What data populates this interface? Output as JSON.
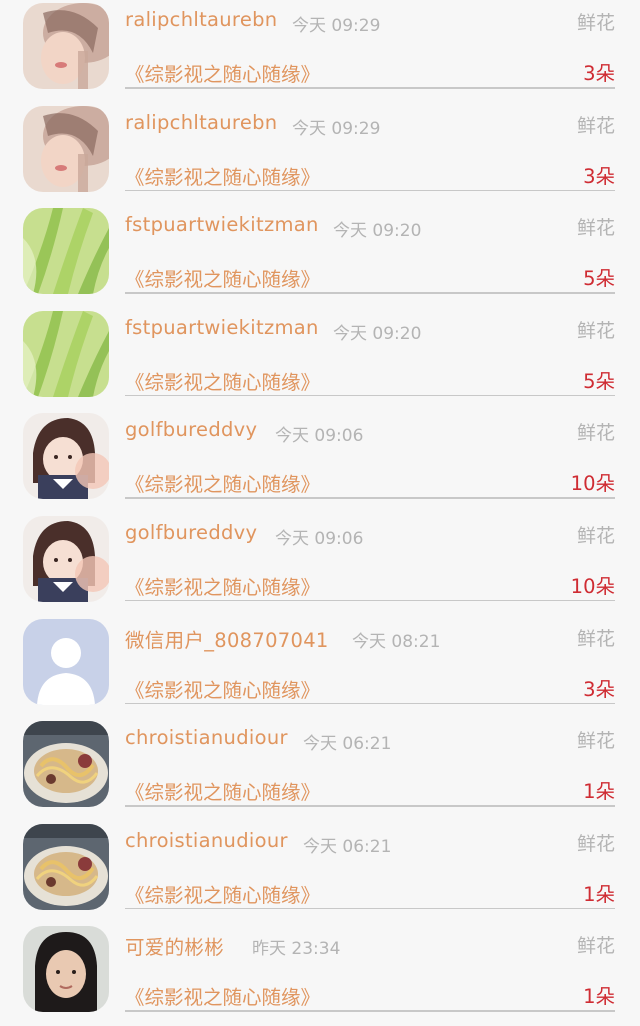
{
  "gift_label": "鲜花",
  "work_title": "《综影视之随心随缘》",
  "rows": [
    {
      "name": "ralipchltaurebn",
      "time": "今天 09:29",
      "count": "3朵",
      "avatar_icon": "user-photo-icon"
    },
    {
      "name": "ralipchltaurebn",
      "time": "今天 09:29",
      "count": "3朵",
      "avatar_icon": "user-photo-icon"
    },
    {
      "name": "fstpuartwiekitzman",
      "time": "今天 09:20",
      "count": "5朵",
      "avatar_icon": "leaf-photo-icon"
    },
    {
      "name": "fstpuartwiekitzman",
      "time": "今天 09:20",
      "count": "5朵",
      "avatar_icon": "leaf-photo-icon"
    },
    {
      "name": "golfbureddvy",
      "time": "今天 09:06",
      "count": "10朵",
      "avatar_icon": "girl-photo-icon"
    },
    {
      "name": "golfbureddvy",
      "time": "今天 09:06",
      "count": "10朵",
      "avatar_icon": "girl-photo-icon"
    },
    {
      "name": "微信用户_808707041",
      "time": "今天 08:21",
      "count": "3朵",
      "avatar_icon": "default-user-icon"
    },
    {
      "name": "chroistianudiour",
      "time": "今天 06:21",
      "count": "1朵",
      "avatar_icon": "food-photo-icon"
    },
    {
      "name": "chroistianudiour",
      "time": "今天 06:21",
      "count": "1朵",
      "avatar_icon": "food-photo-icon"
    },
    {
      "name": "可爱的彬彬",
      "time": "昨天 23:34",
      "count": "1朵",
      "avatar_icon": "user-photo-icon"
    }
  ],
  "colors": {
    "name": "#e0955e",
    "count": "#cf2c33",
    "muted": "#b4b4b4",
    "background": "#f7f7f7"
  }
}
